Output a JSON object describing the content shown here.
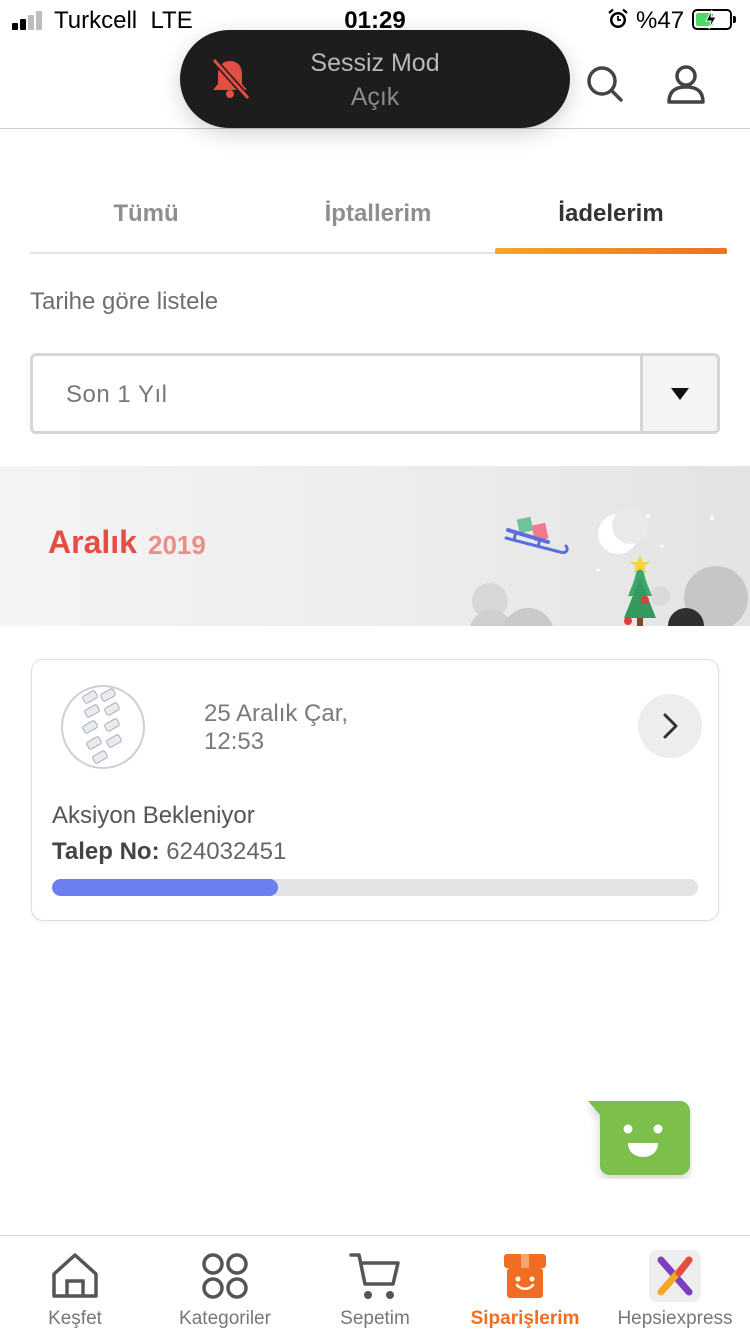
{
  "status_bar": {
    "carrier": "Turkcell",
    "network": "LTE",
    "time": "01:29",
    "battery": "%47",
    "battery_color": "#4cd964"
  },
  "toast": {
    "title": "Sessiz Mod",
    "subtitle": "Açık",
    "icon": "bell-slash-icon"
  },
  "header": {
    "search_icon": "search-icon",
    "account_icon": "user-icon"
  },
  "tabs": [
    {
      "label": "Tümü",
      "active": false
    },
    {
      "label": "İptallerim",
      "active": false
    },
    {
      "label": "İadelerim",
      "active": true
    }
  ],
  "filter": {
    "label": "Tarihe göre listele",
    "selected": "Son 1 Yıl"
  },
  "banner": {
    "month": "Aralık",
    "year": "2019"
  },
  "order": {
    "date": "25 Aralık Çar, 12:53",
    "status": "Aksiyon Bekleniyor",
    "request_label": "Talep No:",
    "request_no": "624032451",
    "progress": 0.35
  },
  "bottom_nav": [
    {
      "label": "Keşfet",
      "icon": "home-icon"
    },
    {
      "label": "Kategoriler",
      "icon": "grid-icon"
    },
    {
      "label": "Sepetim",
      "icon": "cart-icon"
    },
    {
      "label": "Siparişlerim",
      "icon": "package-icon",
      "active": true
    },
    {
      "label": "Hepsiexpress",
      "icon": "hepsiexpress-logo-icon"
    }
  ],
  "colors": {
    "accent": "#f26d21",
    "progress": "#6b80ee",
    "month": "#e24d44",
    "chat": "#7bbf4b"
  }
}
